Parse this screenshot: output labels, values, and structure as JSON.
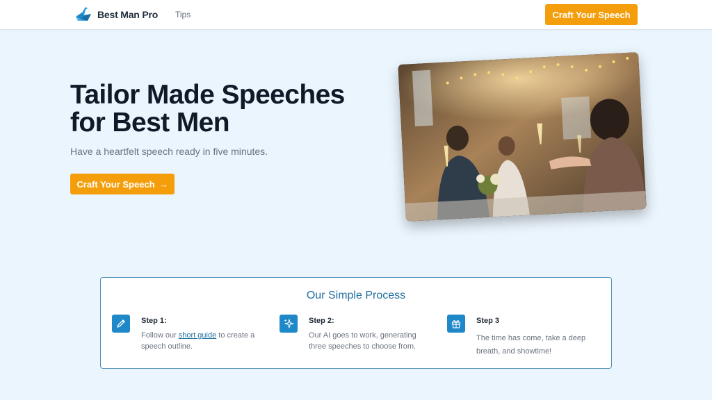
{
  "header": {
    "brand": "Best Man Pro",
    "nav_tips": "Tips",
    "cta_label": "Craft Your Speech"
  },
  "hero": {
    "title_line1": "Tailor Made Speeches",
    "title_line2": "for Best Men",
    "subtitle": "Have a heartfelt speech ready in five minutes.",
    "cta_label": "Craft Your Speech",
    "cta_arrow": "→"
  },
  "process": {
    "title": "Our Simple Process",
    "steps": [
      {
        "title": "Step 1:",
        "desc_before": "Follow our ",
        "link_text": "short guide",
        "desc_after": " to create a speech outline.",
        "icon": "pencil-icon"
      },
      {
        "title": "Step 2:",
        "desc": "Our AI goes to work, generating three speeches to choose from.",
        "icon": "sparkles-icon"
      },
      {
        "title": "Step 3",
        "desc": "The time has come, take a deep breath, and showtime!",
        "icon": "gift-icon"
      }
    ]
  },
  "colors": {
    "page_background": "#ebf5fd",
    "accent_orange": "#f59e0b",
    "accent_blue": "#1e88c9",
    "process_title": "#1f6f9f"
  }
}
